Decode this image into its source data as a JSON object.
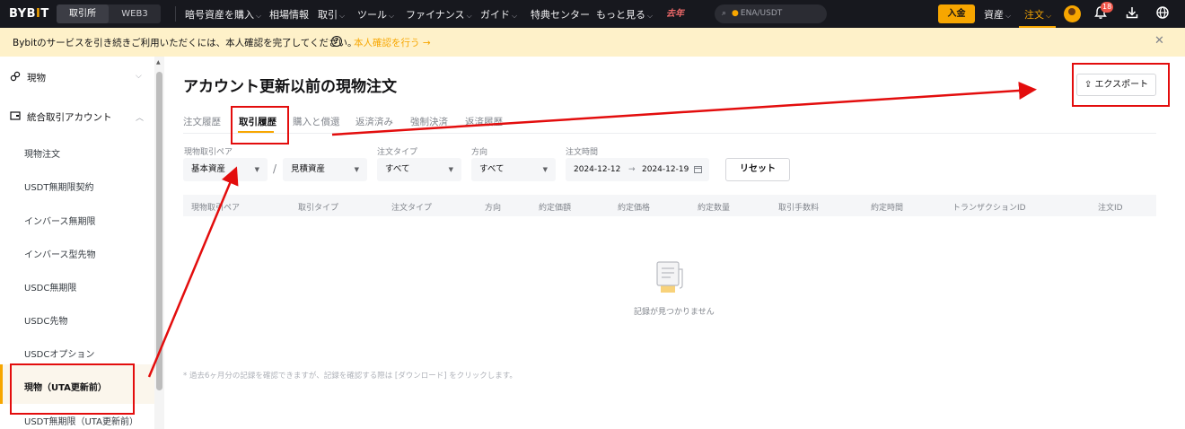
{
  "nav": {
    "logo_main": "BYB",
    "logo_mid": "I",
    "logo_end": "T",
    "seg_exchange": "取引所",
    "seg_web3": "WEB3",
    "items": [
      "暗号資産を購入",
      "相場情報",
      "取引",
      "ツール",
      "ファイナンス",
      "ガイド",
      "特典センター",
      "もっと見る"
    ],
    "promo": "去年",
    "search_placeholder": "ENA/USDT",
    "deposit": "入金",
    "assets": "資産",
    "orders": "注文",
    "badge": "18"
  },
  "notice": {
    "text": "Bybitのサービスを引き続きご利用いただくには、本人確認を完了してください。",
    "link": "本人確認を行う"
  },
  "sidebar": {
    "spot": "現物",
    "unified": "統合取引アカウント",
    "subitems": [
      "現物注文",
      "USDT無期限契約",
      "インバース無期限",
      "インバース型先物",
      "USDC無期限",
      "USDC先物",
      "USDCオプション",
      "現物（UTA更新前）",
      "USDT無期限（UTA更新前）"
    ]
  },
  "main": {
    "title": "アカウント更新以前の現物注文",
    "export": "エクスポート",
    "tabs": [
      "注文履歴",
      "取引履歴",
      "購入と償還",
      "返済済み",
      "強制決済",
      "返済履歴"
    ],
    "filters": {
      "pair_label": "現物取引ペア",
      "base": "基本資産",
      "quote": "見積資産",
      "type_label": "注文タイプ",
      "type_value": "すべて",
      "dir_label": "方向",
      "dir_value": "すべて",
      "time_label": "注文時間",
      "date_from": "2024-12-12",
      "date_to": "2024-12-19",
      "reset": "リセット"
    },
    "columns": [
      "現物取引ペア",
      "取引タイプ",
      "注文タイプ",
      "方向",
      "約定価額",
      "約定価格",
      "約定数量",
      "取引手数料",
      "約定時間",
      "トランザクションID",
      "注文ID"
    ],
    "empty": "記録が見つかりません",
    "footnote": "* 過去6ヶ月分の記録を確認できますが、記録を確認する際は [ダウンロード] をクリックします。"
  },
  "colors": {
    "accent": "#f7a600",
    "annotation": "#e30d0d",
    "nav_bg": "#17181e"
  }
}
